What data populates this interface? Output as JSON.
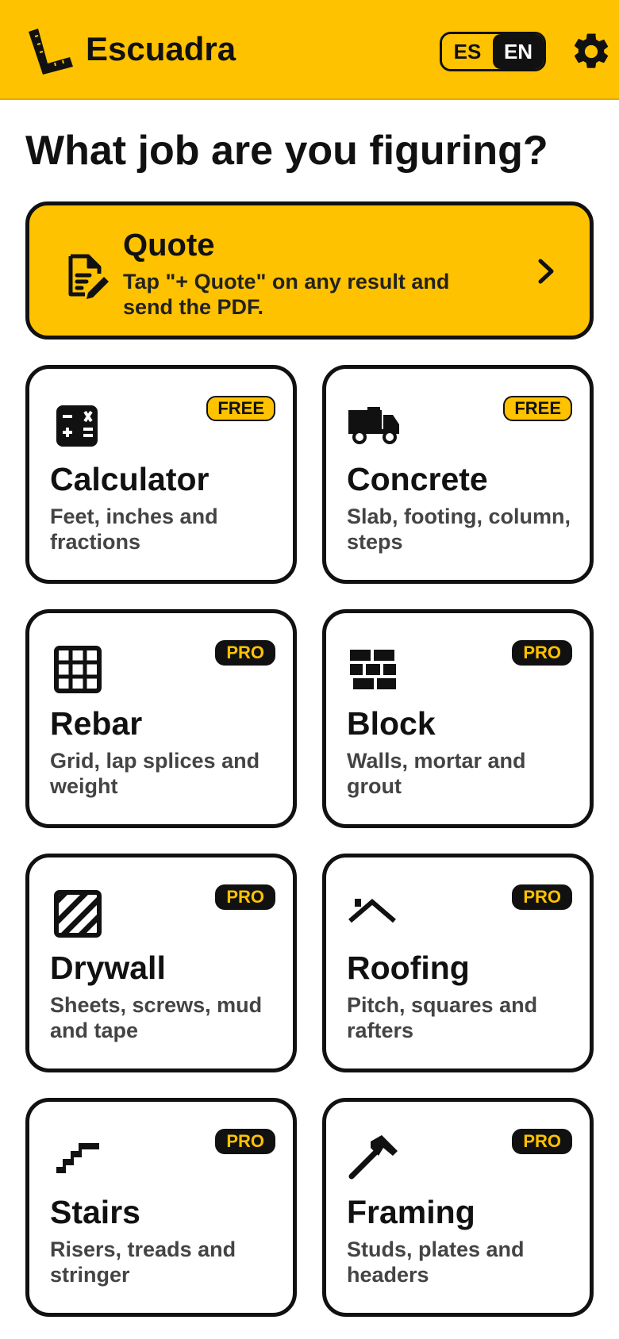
{
  "header": {
    "app_title": "Escuadra",
    "lang": {
      "es": "ES",
      "en": "EN",
      "selected": "EN"
    },
    "logo_icon": "carpenter-square-icon",
    "settings_icon": "gear-icon"
  },
  "colors": {
    "accent": "#FFC200",
    "ink": "#111111",
    "muted": "#444444"
  },
  "page_title": "What job are you figuring?",
  "quote": {
    "title": "Quote",
    "description": "Tap \"+ Quote\" on any result and send the PDF.",
    "icon": "document-edit-icon"
  },
  "cards": [
    {
      "title": "Calculator",
      "description": "Feet, inches and fractions",
      "badge": "FREE",
      "icon": "calculator-icon"
    },
    {
      "title": "Concrete",
      "description": "Slab, footing, column, steps",
      "badge": "FREE",
      "icon": "concrete-truck-icon"
    },
    {
      "title": "Rebar",
      "description": "Grid, lap splices and weight",
      "badge": "PRO",
      "icon": "grid-icon"
    },
    {
      "title": "Block",
      "description": "Walls, mortar and grout",
      "badge": "PRO",
      "icon": "bricks-icon"
    },
    {
      "title": "Drywall",
      "description": "Sheets, screws, mud and tape",
      "badge": "PRO",
      "icon": "hatched-panel-icon"
    },
    {
      "title": "Roofing",
      "description": "Pitch, squares and rafters",
      "badge": "PRO",
      "icon": "roof-icon"
    },
    {
      "title": "Stairs",
      "description": "Risers, treads and stringer",
      "badge": "PRO",
      "icon": "stairs-icon"
    },
    {
      "title": "Framing",
      "description": "Studs, plates and headers",
      "badge": "PRO",
      "icon": "hammer-icon"
    }
  ]
}
